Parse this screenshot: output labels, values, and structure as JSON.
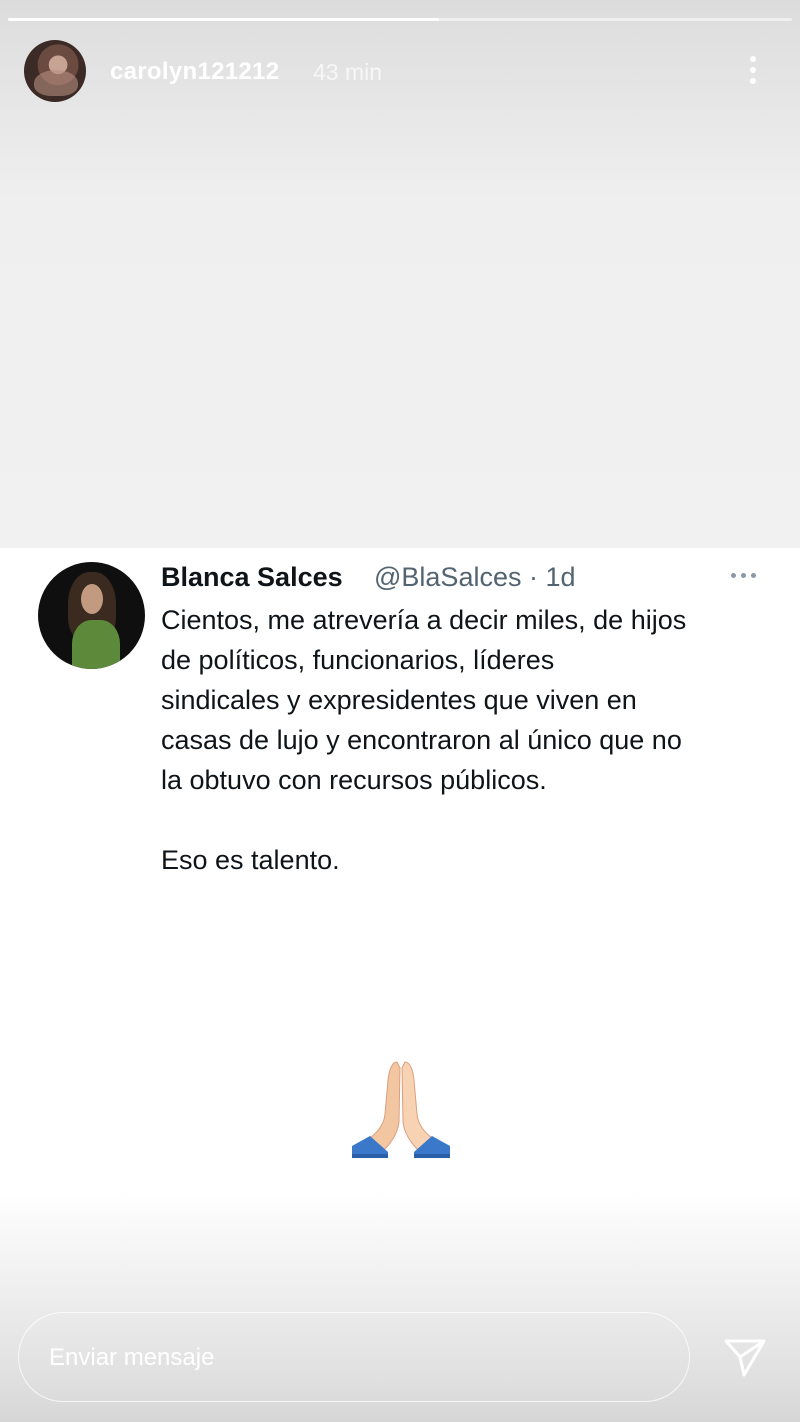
{
  "story": {
    "progress": 0.55,
    "username": "carolyn121212",
    "time": "43 min"
  },
  "tweet": {
    "name": "Blanca Salces",
    "handle": "@BlaSalces · 1d",
    "lines": [
      "Cientos, me atrevería a decir miles, de hijos",
      "de políticos, funcionarios, líderes",
      "sindicales y expresidentes que viven en",
      "casas de lujo y encontraron al único que no",
      "la obtuvo con recursos públicos."
    ],
    "closing": "Eso es talento."
  },
  "sticker": {
    "emoji": "folded-hands"
  },
  "reply": {
    "placeholder": "Enviar mensaje"
  }
}
